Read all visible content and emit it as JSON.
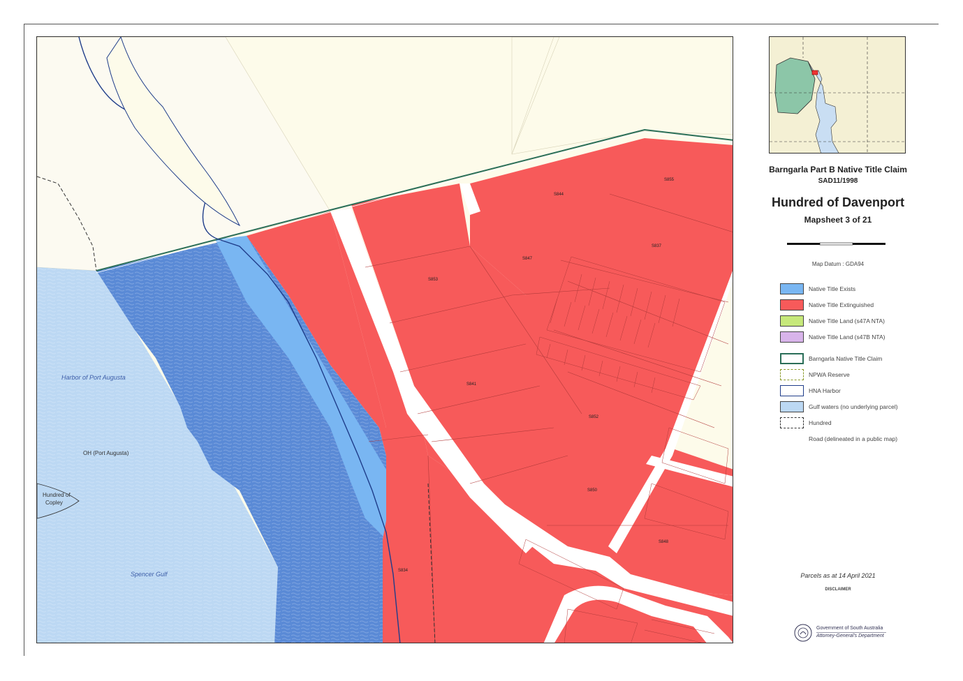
{
  "colors": {
    "native_title_exists": "#79b6f2",
    "native_title_extinguished": "#f75a5a",
    "native_title_land_s47a": "#c6e87a",
    "native_title_land_s47b": "#d8b4ea",
    "claim_boundary": "#2a6e58",
    "harbor_boundary": "#1f3d8a",
    "gulf_waters": "#bcd8f3",
    "deep_water": "#5a8ad6",
    "land_background": "#fdfbea",
    "road": "#ffffff"
  },
  "map": {
    "water_labels": {
      "port_augusta_harbor": "Harbor of Port Augusta",
      "gulf": "Spencer Gulf"
    },
    "area_labels": {
      "oh": "OH (Port Augusta)",
      "hundred_copley_line1": "Hundred of",
      "hundred_copley_line2": "Copley"
    },
    "parcels": [
      {
        "id": "S847",
        "label": "S847"
      },
      {
        "id": "S844",
        "label": "S844"
      },
      {
        "id": "S853",
        "label": "S853"
      },
      {
        "id": "S837",
        "label": "S837"
      },
      {
        "id": "S855",
        "label": "S855"
      },
      {
        "id": "S841",
        "label": "S841"
      },
      {
        "id": "S852",
        "label": "S852"
      },
      {
        "id": "S850",
        "label": "S850"
      },
      {
        "id": "S848",
        "label": "S848"
      },
      {
        "id": "S834",
        "label": "S834"
      }
    ],
    "road_label": "Road"
  },
  "legend": {
    "title": "Barngarla Part B Native Title Claim",
    "claim_id": "SAD11/1998",
    "hundred": "Hundred of Davenport",
    "mapsheet": "Mapsheet 3 of 21",
    "datum": "Map Datum : GDA94",
    "items": [
      {
        "key": "native_title_exists",
        "label": "Native Title Exists"
      },
      {
        "key": "native_title_extinguished",
        "label": "Native Title Extinguished"
      },
      {
        "key": "native_title_land_s47a",
        "label": "Native Title Land (s47A NTA)"
      },
      {
        "key": "native_title_land_s47b",
        "label": "Native Title Land (s47B NTA)"
      },
      {
        "key": "barngarla_claim",
        "label": "Barngarla Native Title Claim"
      },
      {
        "key": "npwa_reserve",
        "label": "NPWA Reserve"
      },
      {
        "key": "hna_harbor",
        "label": "HNA Harbor"
      },
      {
        "key": "gulf_waters",
        "label": "Gulf waters (no underlying parcel)"
      },
      {
        "key": "hundred_boundary",
        "label": "Hundred"
      },
      {
        "key": "road",
        "label": "Road (delineated in a public map)"
      }
    ],
    "parcels_date": "Parcels as at 14 April 2021",
    "disclaimer_title": "DISCLAIMER",
    "government": "Government of South Australia",
    "department": "Attorney-General's Department"
  }
}
